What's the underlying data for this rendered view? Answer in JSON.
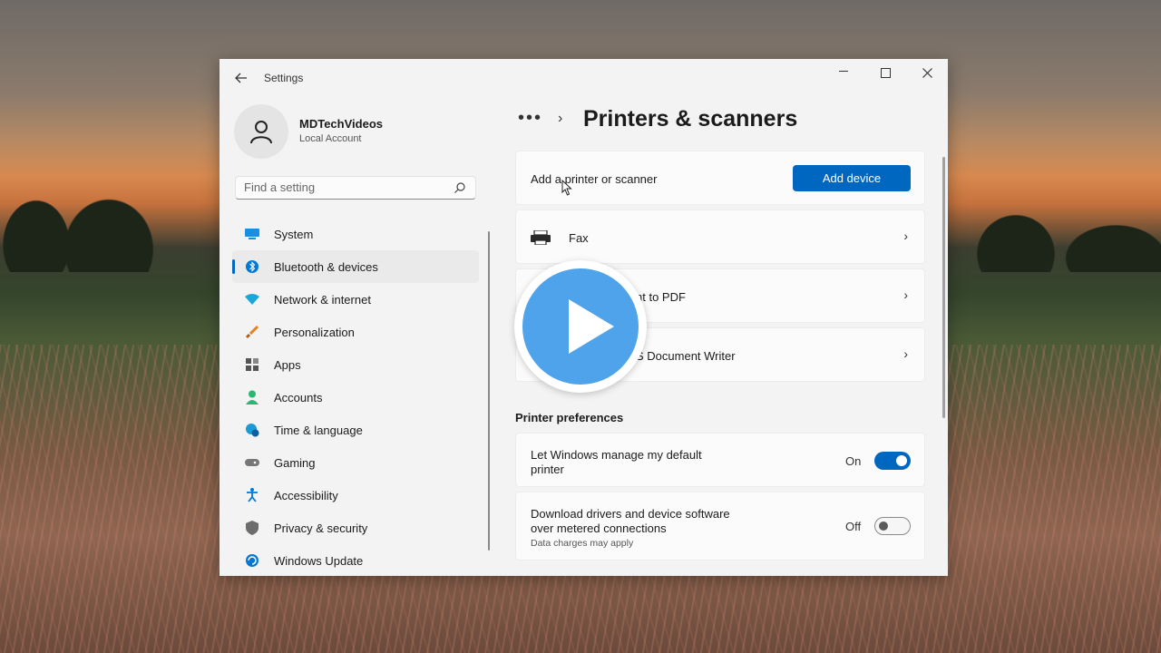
{
  "window": {
    "app_title": "Settings",
    "minimize_label": "—",
    "maximize_label": "☐",
    "close_label": "✕"
  },
  "profile": {
    "name": "MDTechVideos",
    "account_type": "Local Account"
  },
  "search": {
    "placeholder": "Find a setting"
  },
  "sidebar": {
    "items": [
      {
        "label": "System",
        "icon": "monitor-icon",
        "color": "#0078d4"
      },
      {
        "label": "Bluetooth & devices",
        "icon": "bluetooth-icon",
        "color": "#0078d4",
        "active": true
      },
      {
        "label": "Network & internet",
        "icon": "wifi-icon",
        "color": "#1aa6d9"
      },
      {
        "label": "Personalization",
        "icon": "brush-icon",
        "color": "#e67e22"
      },
      {
        "label": "Apps",
        "icon": "apps-icon",
        "color": "#555555"
      },
      {
        "label": "Accounts",
        "icon": "person-icon",
        "color": "#2bb673"
      },
      {
        "label": "Time & language",
        "icon": "globe-clock-icon",
        "color": "#1a9ad6"
      },
      {
        "label": "Gaming",
        "icon": "gamepad-icon",
        "color": "#777777"
      },
      {
        "label": "Accessibility",
        "icon": "accessibility-icon",
        "color": "#0078d4"
      },
      {
        "label": "Privacy & security",
        "icon": "shield-icon",
        "color": "#6d6d6d"
      },
      {
        "label": "Windows Update",
        "icon": "update-icon",
        "color": "#0078d4"
      }
    ]
  },
  "main": {
    "breadcrumb_more": "•••",
    "breadcrumb_sep": "›",
    "title": "Printers & scanners",
    "add_row": {
      "label": "Add a printer or scanner",
      "button": "Add device"
    },
    "devices": [
      {
        "label": "Fax"
      },
      {
        "label": "nt to PDF"
      },
      {
        "label": "S Document Writer"
      }
    ],
    "chevron": "›",
    "preferences_heading": "Printer preferences",
    "preferences": [
      {
        "label_line1": "Let Windows manage my default",
        "label_line2": "printer",
        "state": "On",
        "on": true
      },
      {
        "label_line1": "Download drivers and device software",
        "label_line2": "over metered connections",
        "sub": "Data charges may apply",
        "state": "Off",
        "on": false
      }
    ]
  },
  "overlay": {
    "play_icon": "play-icon"
  }
}
